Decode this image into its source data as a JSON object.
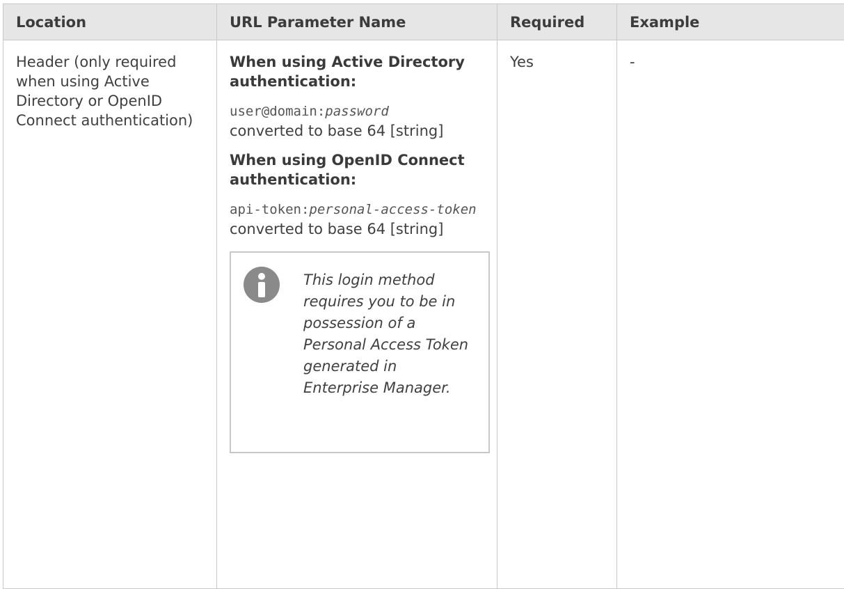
{
  "table": {
    "headers": {
      "location": "Location",
      "param_name": "URL Parameter Name",
      "required": "Required",
      "example": "Example"
    },
    "row": {
      "location": "Header (only required when using Active Directory or OpenID Connect authentication)",
      "ad_heading": "When using Active Directory authentication:",
      "ad_code_plain": "user@domain:",
      "ad_code_italic": "password",
      "ad_suffix": "converted to base 64 [string]",
      "oidc_heading": "When using OpenID Connect authentication:",
      "oidc_code_plain": "api-token:",
      "oidc_code_italic": "personal-access-token",
      "oidc_suffix": " converted to base 64 [string]",
      "note": "This login method requires you to be in possession of a Personal Access Token generated in Enterprise Manager.",
      "note_icon": "info-icon",
      "required": "Yes",
      "example": "-"
    }
  }
}
